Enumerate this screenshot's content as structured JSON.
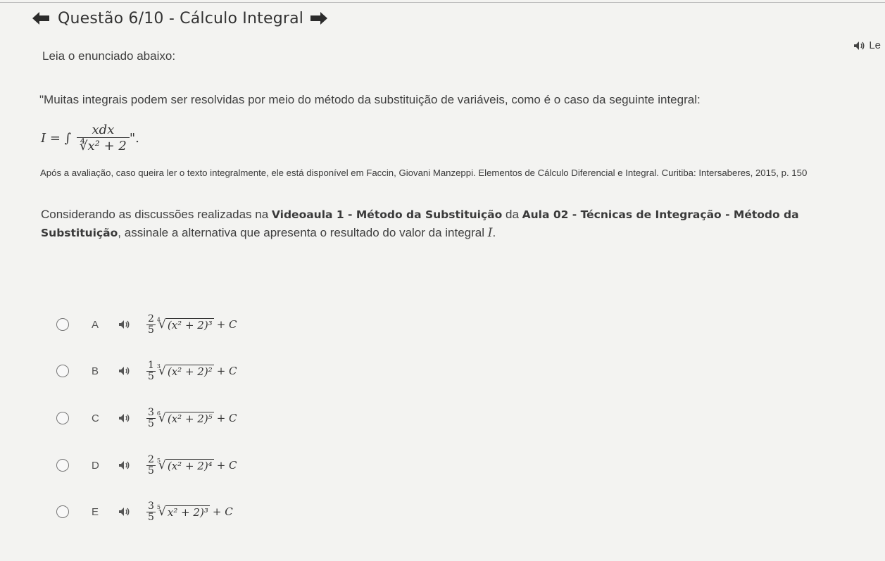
{
  "header": {
    "title": "Questão 6/10 - Cálculo Integral"
  },
  "listen_label": "Le",
  "intro": "Leia o enunciado abaixo:",
  "quote": "\"Muitas integrais podem ser resolvidas por meio do método da substituição de variáveis, como é o caso da seguinte integral:",
  "formula": {
    "lhs": "I = ∫",
    "numerator": "xdx",
    "denominator_root": "∜",
    "denominator_radicand": "x² + 2",
    "close": "\"."
  },
  "source": "Após a avaliação, caso queira ler o texto integralmente, ele está disponível em Faccin, Giovani Manzeppi. Elementos de Cálculo Diferencial e Integral. Curitiba: Intersaberes, 2015, p. 150",
  "consider": {
    "part1": "Considerando as discussões realizadas na ",
    "bold1": "Videoaula 1 - Método da Substituição",
    "part2": " da ",
    "bold2": "Aula 02 - Técnicas de Integração - Método da Substituição",
    "part3": ", assinale a alternativa que apresenta o resultado do valor da integral ",
    "var": "I",
    "end": "."
  },
  "options": [
    {
      "letter": "A",
      "num": "2",
      "den": "5",
      "index": "4",
      "radicand": "(x² + 2)³",
      "tail": "+ C"
    },
    {
      "letter": "B",
      "num": "1",
      "den": "5",
      "index": "3",
      "radicand": "(x² + 2)²",
      "tail": "+ C"
    },
    {
      "letter": "C",
      "num": "3",
      "den": "5",
      "index": "6",
      "radicand": "(x² + 2)⁵",
      "tail": "+ C"
    },
    {
      "letter": "D",
      "num": "2",
      "den": "5",
      "index": "5",
      "radicand": "(x² + 2)⁴",
      "tail": "+ C"
    },
    {
      "letter": "E",
      "num": "3",
      "den": "5",
      "index": "5",
      "radicand": "x² + 2)³",
      "tail": "+ C"
    }
  ]
}
